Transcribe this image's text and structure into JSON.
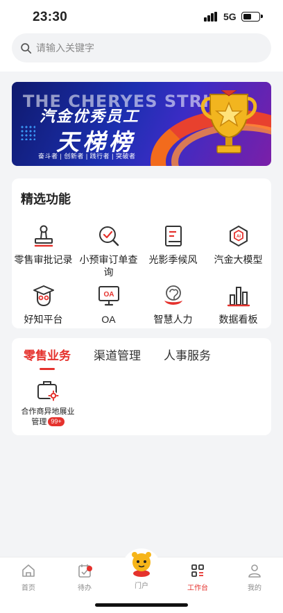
{
  "status": {
    "time": "23:30",
    "network": "5G"
  },
  "search": {
    "placeholder": "请输入关键字"
  },
  "banner": {
    "bg_text": "THE CHERYES STRIVE",
    "title_line1": "汽金优秀员工",
    "title_line2": "天梯榜",
    "tags": "奋斗者 | 创新者 | 践行者 | 突破者"
  },
  "features": {
    "title": "精选功能",
    "items": [
      {
        "label": "零售审批记录",
        "icon": "stamp-icon"
      },
      {
        "label": "小预审订单查询",
        "icon": "search-check-icon"
      },
      {
        "label": "光影季候风",
        "icon": "book-icon"
      },
      {
        "label": "汽金大模型",
        "icon": "ai-cube-icon"
      },
      {
        "label": "好知平台",
        "icon": "owl-graduate-icon"
      },
      {
        "label": "OA",
        "icon": "oa-monitor-icon"
      },
      {
        "label": "智慧人力",
        "icon": "elephant-logo-icon"
      },
      {
        "label": "数据看板",
        "icon": "bar-chart-icon"
      }
    ]
  },
  "business": {
    "tabs": [
      "零售业务",
      "渠道管理",
      "人事服务"
    ],
    "active_tab": "零售业务",
    "items": [
      {
        "label": "合作商异地展业管理",
        "badge": "99+"
      }
    ]
  },
  "tabbar": {
    "items": [
      {
        "label": "首页",
        "icon": "home-icon"
      },
      {
        "label": "待办",
        "icon": "todo-calendar-icon"
      },
      {
        "label": "门户",
        "icon": "mascot-icon"
      },
      {
        "label": "工作台",
        "icon": "workbench-grid-icon"
      },
      {
        "label": "我的",
        "icon": "user-icon"
      }
    ],
    "active": "工作台"
  },
  "colors": {
    "accent": "#e5322d",
    "background": "#f3f4f6"
  }
}
